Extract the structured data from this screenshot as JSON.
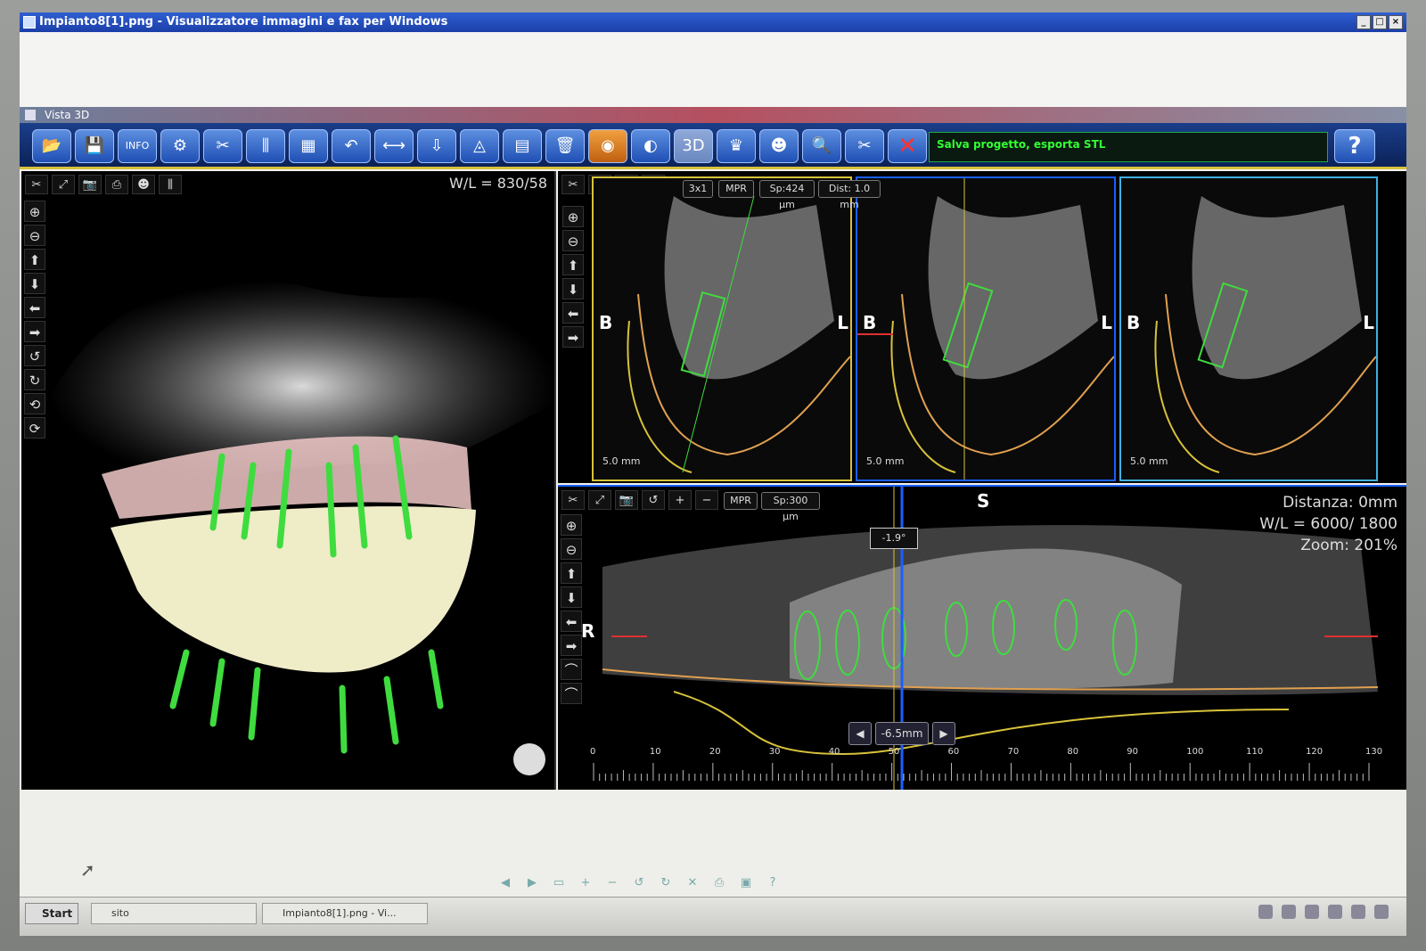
{
  "window": {
    "title": "Impianto8[1].png - Visualizzatore immagini e fax per Windows",
    "controls": [
      "_",
      "□",
      "×"
    ]
  },
  "inner_window": {
    "title": "Vista 3D"
  },
  "toolbar": {
    "buttons": [
      {
        "name": "open-project-button",
        "glyph": "📂"
      },
      {
        "name": "save-button",
        "glyph": "💾"
      },
      {
        "name": "info-button",
        "glyph": "INFO"
      },
      {
        "name": "settings-button",
        "glyph": "⚙"
      },
      {
        "name": "tools-button",
        "glyph": "✂"
      },
      {
        "name": "implant-button",
        "glyph": "⫼"
      },
      {
        "name": "calculator-button",
        "glyph": "▦"
      },
      {
        "name": "undo-button",
        "glyph": "↶"
      },
      {
        "name": "measure-button",
        "glyph": "⟷"
      },
      {
        "name": "export-button",
        "glyph": "⇩"
      },
      {
        "name": "angle-button",
        "glyph": "◬"
      },
      {
        "name": "report-button",
        "glyph": "▤"
      },
      {
        "name": "delete-button",
        "glyph": "🗑"
      },
      {
        "name": "view-button",
        "glyph": "◉"
      },
      {
        "name": "contrast-button",
        "glyph": "◐"
      },
      {
        "name": "3d-button",
        "glyph": "3D"
      },
      {
        "name": "arch-button",
        "glyph": "♛"
      },
      {
        "name": "head-button",
        "glyph": "☻"
      },
      {
        "name": "search-button",
        "glyph": "🔍"
      },
      {
        "name": "cut-button",
        "glyph": "✂"
      },
      {
        "name": "close-button",
        "glyph": "✕"
      }
    ],
    "status": "Salva progetto, esporta STL",
    "help": "?"
  },
  "panel_3d": {
    "top_tools": [
      "✂",
      "⤢",
      "📷",
      "⎙",
      "☻",
      "⫼"
    ],
    "side_tools": [
      "⊕",
      "⊖",
      "⬆",
      "⬇",
      "⬅",
      "➡",
      "↺",
      "↻",
      "⟲",
      "⟳"
    ],
    "wl": "W/L = 830/58"
  },
  "slices": {
    "tools": [
      "✂",
      "⤢",
      "📷",
      "↺"
    ],
    "pills": [
      "3x1",
      "MPR",
      "Sp:424 µm",
      "Dist: 1.0 mm"
    ],
    "side_tools": [
      "⊕",
      "⊖",
      "⬆",
      "⬇",
      "⬅",
      "➡"
    ],
    "label_b": "B",
    "label_l": "L",
    "scale": "5.0 mm"
  },
  "pano": {
    "tools": [
      "✂",
      "⤢",
      "📷",
      "↺",
      "+",
      "−"
    ],
    "pills": [
      "MPR",
      "Sp:300 µm"
    ],
    "side_tools": [
      "⊕",
      "⊖",
      "⬆",
      "⬇",
      "⬅",
      "➡",
      "⌒",
      "⌒"
    ],
    "distance": "Distanza: 0mm",
    "wl": "W/L = 6000/ 1800",
    "zoom": "Zoom: 201%",
    "s_label": "S",
    "r_label": "R",
    "angle": "-1.9°",
    "nav_value": "-6.5mm",
    "ruler_ticks": [
      "0",
      "10",
      "20",
      "30",
      "40",
      "50",
      "60",
      "70",
      "80",
      "90",
      "100",
      "110",
      "120",
      "130"
    ]
  },
  "taskbar": {
    "start": "Start",
    "items": [
      "sito",
      "Impianto8[1].png - Vi..."
    ]
  }
}
